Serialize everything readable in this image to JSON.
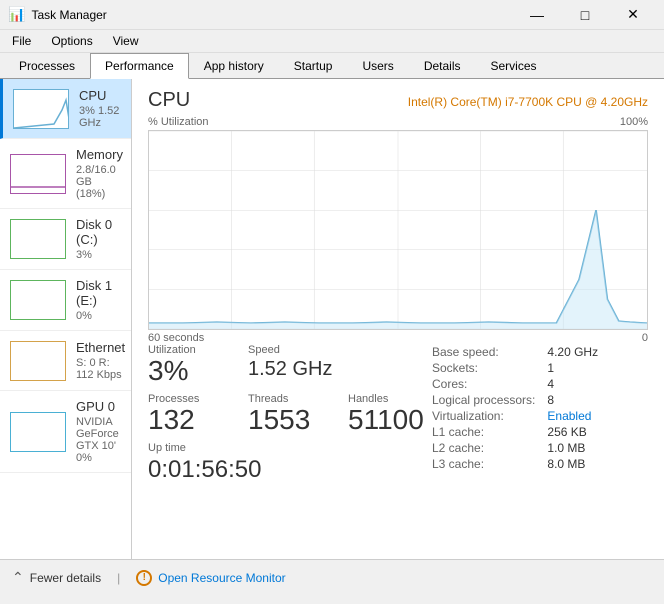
{
  "titleBar": {
    "title": "Task Manager",
    "controls": {
      "minimize": "—",
      "maximize": "□",
      "close": "✕"
    }
  },
  "menuBar": {
    "items": [
      "File",
      "Options",
      "View"
    ]
  },
  "tabs": {
    "items": [
      "Processes",
      "Performance",
      "App history",
      "Startup",
      "Users",
      "Details",
      "Services"
    ],
    "active": "Performance"
  },
  "leftPanel": {
    "resources": [
      {
        "id": "cpu",
        "name": "CPU",
        "detail": "3% 1.52 GHz",
        "active": true,
        "colorClass": "cpu-border"
      },
      {
        "id": "memory",
        "name": "Memory",
        "detail": "2.8/16.0 GB (18%)",
        "active": false,
        "colorClass": "memory-border"
      },
      {
        "id": "disk0",
        "name": "Disk 0 (C:)",
        "detail": "3%",
        "active": false,
        "colorClass": "disk0-border"
      },
      {
        "id": "disk1",
        "name": "Disk 1 (E:)",
        "detail": "0%",
        "active": false,
        "colorClass": "disk1-border"
      },
      {
        "id": "ethernet",
        "name": "Ethernet",
        "detail": "S: 0 R: 112 Kbps",
        "active": false,
        "colorClass": "ethernet-border"
      },
      {
        "id": "gpu0",
        "name": "GPU 0",
        "detail": "NVIDIA GeForce GTX 10'\n0%",
        "detail2": "0%",
        "active": false,
        "colorClass": "gpu-border"
      }
    ]
  },
  "rightPanel": {
    "title": "CPU",
    "model": "Intel(R) Core(TM) i7-7700K CPU @ 4.20GHz",
    "chartLabel": "% Utilization",
    "chartMax": "100%",
    "chartTimeLabel": "60 seconds",
    "chartTimeRight": "0",
    "stats": {
      "utilization": {
        "label": "Utilization",
        "value": "3%"
      },
      "speed": {
        "label": "Speed",
        "value": "1.52 GHz"
      },
      "processes": {
        "label": "Processes",
        "value": "132"
      },
      "threads": {
        "label": "Threads",
        "value": "1553"
      },
      "handles": {
        "label": "Handles",
        "value": "51100"
      },
      "uptime": {
        "label": "Up time",
        "value": "0:01:56:50"
      }
    },
    "sysInfo": {
      "baseSpeed": {
        "label": "Base speed:",
        "value": "4.20 GHz"
      },
      "sockets": {
        "label": "Sockets:",
        "value": "1"
      },
      "cores": {
        "label": "Cores:",
        "value": "4"
      },
      "logicalProcessors": {
        "label": "Logical processors:",
        "value": "8"
      },
      "virtualization": {
        "label": "Virtualization:",
        "value": "Enabled"
      },
      "l1Cache": {
        "label": "L1 cache:",
        "value": "256 KB"
      },
      "l2Cache": {
        "label": "L2 cache:",
        "value": "1.0 MB"
      },
      "l3Cache": {
        "label": "L3 cache:",
        "value": "8.0 MB"
      }
    }
  },
  "footer": {
    "fewerDetails": "Fewer details",
    "openResourceMonitor": "Open Resource Monitor"
  }
}
